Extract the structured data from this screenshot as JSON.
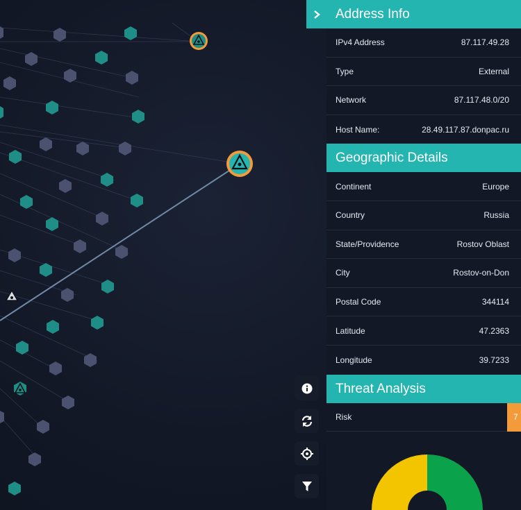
{
  "address_info": {
    "title": "Address Info",
    "rows": [
      {
        "label": "IPv4 Address",
        "value": "87.117.49.28"
      },
      {
        "label": "Type",
        "value": "External"
      },
      {
        "label": "Network",
        "value": "87.117.48.0/20"
      },
      {
        "label": "Host Name:",
        "value": "28.49.117.87.donpac.ru"
      }
    ]
  },
  "geographic": {
    "title": "Geographic Details",
    "rows": [
      {
        "label": "Continent",
        "value": "Europe"
      },
      {
        "label": "Country",
        "value": "Russia"
      },
      {
        "label": "State/Providence",
        "value": "Rostov Oblast"
      },
      {
        "label": "City",
        "value": "Rostov-on-Don"
      },
      {
        "label": "Postal Code",
        "value": "344114"
      },
      {
        "label": "Latitude",
        "value": "47.2363"
      },
      {
        "label": "Longitude",
        "value": "39.7233"
      }
    ]
  },
  "threat": {
    "title": "Threat Analysis",
    "risk_label": "Risk",
    "risk_value": "7",
    "donut": {
      "yellow_fraction": 0.5,
      "green_fraction": 0.5
    }
  },
  "toolbar": {
    "buttons": [
      "info-icon",
      "refresh-icon",
      "crosshair-icon",
      "filter-icon"
    ]
  },
  "colors": {
    "accent": "#24b5b0",
    "node_teal": "#1f8e86",
    "node_gray": "#4a5270",
    "highlight_orange": "#f39a3a",
    "risk_orange": "#f39a3a",
    "donut_yellow": "#f2c500",
    "donut_green": "#0aa24a"
  }
}
